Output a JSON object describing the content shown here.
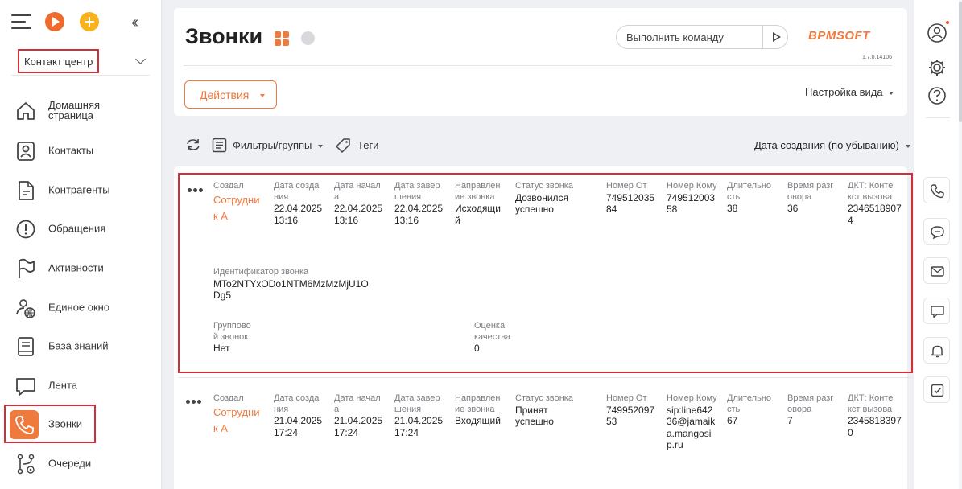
{
  "sidebar": {
    "workspace": "Контакт центр",
    "items": [
      {
        "label": "Домашняя страница",
        "icon": "home-icon"
      },
      {
        "label": "Контакты",
        "icon": "contact-card-icon"
      },
      {
        "label": "Контрагенты",
        "icon": "document-icon"
      },
      {
        "label": "Обращения",
        "icon": "alert-icon"
      },
      {
        "label": "Активности",
        "icon": "flag-icon"
      },
      {
        "label": "Единое окно",
        "icon": "user-globe-icon"
      },
      {
        "label": "База знаний",
        "icon": "book-icon"
      },
      {
        "label": "Лента",
        "icon": "chat-bubble-icon"
      },
      {
        "label": "Звонки",
        "icon": "phone-icon",
        "active": true
      },
      {
        "label": "Очереди",
        "icon": "queue-icon"
      }
    ]
  },
  "header": {
    "title": "Звонки",
    "command_placeholder": "Выполнить команду",
    "logo": "BPMSOFT",
    "version": "1.7.0.14106",
    "actions_label": "Действия",
    "view_settings_label": "Настройка вида"
  },
  "toolbar": {
    "filters_label": "Фильтры/группы",
    "tags_label": "Теги",
    "sort_label": "Дата создания (по убыванию)"
  },
  "records": [
    {
      "created_by_label": "Создал",
      "created_by": "Сотрудник А",
      "created_label": "Дата создания",
      "created": "22.04.2025 13:16",
      "start_label": "Дата начала",
      "start": "22.04.2025 13:16",
      "end_label": "Дата завершения",
      "end": "22.04.2025 13:16",
      "direction_label": "Направление звонка",
      "direction": "Исходящий",
      "status_label": "Статус звонка",
      "status": "Дозвонился успешно",
      "from_label": "Номер От",
      "from": "74951203584",
      "to_label": "Номер Кому",
      "to": "74951200358",
      "duration_label": "Длительность",
      "duration": "38",
      "talk_label": "Время разговора",
      "talk": "36",
      "context_label": "ДКТ: Контекст вызова",
      "context": "23465189074",
      "call_id_label": "Идентификатор звонка",
      "call_id": "MTo2NTYxODo1NTM6MzMzMjU1ODg5",
      "group_label": "Групповой звонок",
      "group": "Нет",
      "quality_label": "Оценка качества",
      "quality": "0"
    },
    {
      "created_by_label": "Создал",
      "created_by": "Сотрудник А",
      "created_label": "Дата создания",
      "created": "21.04.2025 17:24",
      "start_label": "Дата начала",
      "start": "21.04.2025 17:24",
      "end_label": "Дата завершения",
      "end": "21.04.2025 17:24",
      "direction_label": "Направление звонка",
      "direction": "Входящий",
      "status_label": "Статус звонка",
      "status": "Принят успешно",
      "from_label": "Номер От",
      "from": "74995209753",
      "to_label": "Номер Кому",
      "to": "sip:line64236@jamaika.mangosip.ru",
      "duration_label": "Длительность",
      "duration": "67",
      "talk_label": "Время разговора",
      "talk": "7",
      "context_label": "ДКТ: Контекст вызова",
      "context": "23458183970"
    }
  ],
  "colors": {
    "accent": "#ef7a3d",
    "highlight": "#d32f3b"
  }
}
